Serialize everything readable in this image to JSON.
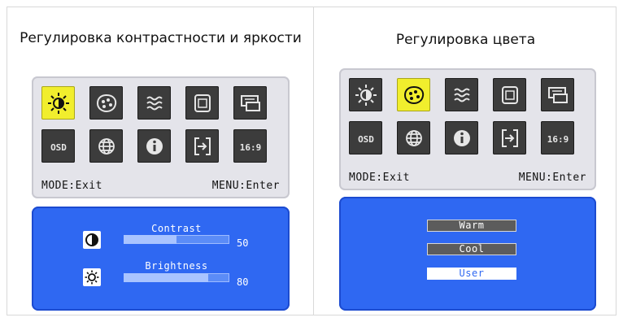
{
  "left_panel": {
    "caption": "Регулировка контрастности и яркости",
    "osd_icons": [
      {
        "name": "contrast-brightness-icon",
        "selected": true
      },
      {
        "name": "color-icon",
        "selected": false
      },
      {
        "name": "image-settings-icon",
        "selected": false
      },
      {
        "name": "position-icon",
        "selected": false
      },
      {
        "name": "setup-icon",
        "selected": false
      },
      {
        "name": "osd-settings-icon",
        "selected": false
      },
      {
        "name": "language-icon",
        "selected": false
      },
      {
        "name": "information-icon",
        "selected": false
      },
      {
        "name": "input-select-icon",
        "selected": false
      },
      {
        "name": "aspect-ratio-icon",
        "selected": false
      }
    ],
    "osd_tile_labels": {
      "osd": "OSD",
      "aspect": "16:9"
    },
    "hint_mode": "MODE:Exit",
    "hint_menu": "MENU:Enter",
    "adjustments": [
      {
        "label": "Contrast",
        "value": "50",
        "level": 0.5,
        "icon": "contrast-icon"
      },
      {
        "label": "Brightness",
        "value": "80",
        "level": 0.8,
        "icon": "brightness-icon"
      }
    ]
  },
  "right_panel": {
    "caption": "Регулировка цвета",
    "osd_icons": [
      {
        "name": "contrast-brightness-icon",
        "selected": false
      },
      {
        "name": "color-icon",
        "selected": true
      },
      {
        "name": "image-settings-icon",
        "selected": false
      },
      {
        "name": "position-icon",
        "selected": false
      },
      {
        "name": "setup-icon",
        "selected": false
      },
      {
        "name": "osd-settings-icon",
        "selected": false
      },
      {
        "name": "language-icon",
        "selected": false
      },
      {
        "name": "information-icon",
        "selected": false
      },
      {
        "name": "input-select-icon",
        "selected": false
      },
      {
        "name": "aspect-ratio-icon",
        "selected": false
      }
    ],
    "hint_mode": "MODE:Exit",
    "hint_menu": "MENU:Enter",
    "color_options": [
      {
        "label": "Warm",
        "active": false
      },
      {
        "label": "Cool",
        "active": false
      },
      {
        "label": "User",
        "active": true
      }
    ]
  },
  "colors": {
    "selected_tile": "#f1ee2d",
    "osd_blue": "#2f68f2",
    "tile_dark": "#3c3c3c"
  }
}
